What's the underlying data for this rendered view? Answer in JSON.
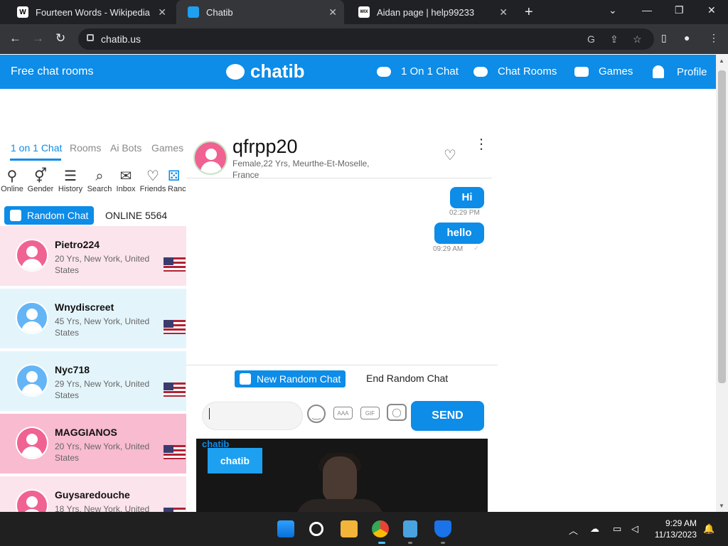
{
  "browser": {
    "tabs": [
      {
        "title": "Fourteen Words - Wikipedia",
        "favicon": "W"
      },
      {
        "title": "Chatib",
        "favicon": "chat"
      },
      {
        "title": "Aidan page | help99233",
        "favicon": "WIX"
      }
    ],
    "url": "chatib.us"
  },
  "site": {
    "brand_left": "Free chat rooms",
    "logo": "chatib",
    "nav": [
      "1 On 1 Chat",
      "Chat Rooms",
      "Games",
      "Profile"
    ]
  },
  "left_panel": {
    "tabs": [
      "1 on 1 Chat",
      "Rooms",
      "Ai Bots",
      "Games"
    ],
    "icons": [
      {
        "label": "Online",
        "icon": "person-icon"
      },
      {
        "label": "Gender",
        "icon": "gender-icon"
      },
      {
        "label": "History",
        "icon": "list-icon"
      },
      {
        "label": "Search",
        "icon": "search-icon"
      },
      {
        "label": "Inbox",
        "icon": "mail-icon"
      },
      {
        "label": "Friends",
        "icon": "heart-icon"
      },
      {
        "label": "Ranc",
        "icon": "dice-icon"
      }
    ],
    "random_chat_label": "Random Chat",
    "online_label": "ONLINE 5564",
    "users": [
      {
        "name": "Pietro224",
        "desc": "20 Yrs, New York, United States",
        "gender": "female"
      },
      {
        "name": "Wnydiscreet",
        "desc": "45 Yrs, New York, United States",
        "gender": "male"
      },
      {
        "name": "Nyc718",
        "desc": "29 Yrs, New York, United States",
        "gender": "male"
      },
      {
        "name": "MAGGIANOS",
        "desc": "20 Yrs, New York, United States",
        "gender": "female"
      },
      {
        "name": "Guysaredouche",
        "desc": "18 Yrs, New York, United",
        "gender": "female"
      }
    ]
  },
  "chat": {
    "name": "qfrpp20",
    "sub": "Female,22 Yrs, Meurthe-Et-Moselle, France",
    "messages": [
      {
        "text": "Hi",
        "time": "02:29 PM"
      },
      {
        "text": "hello",
        "time": "09:29 AM"
      }
    ],
    "new_random_chat": "New Random Chat",
    "end_random_chat": "End Random Chat",
    "input_value": "",
    "tool_aaa": "AAA",
    "tool_gif": "GIF",
    "send_label": "SEND"
  },
  "video": {
    "watermark": "chatib",
    "badge": "chatib"
  },
  "taskbar": {
    "time": "9:29 AM",
    "date": "11/13/2023"
  },
  "colors": {
    "brand_blue": "#0d8ce8",
    "female_bg": "#fce4ec",
    "male_bg": "#e3f5fb",
    "selected_bg": "#f8bbd0",
    "female_avatar": "#f06292",
    "male_avatar": "#64b5f6"
  }
}
